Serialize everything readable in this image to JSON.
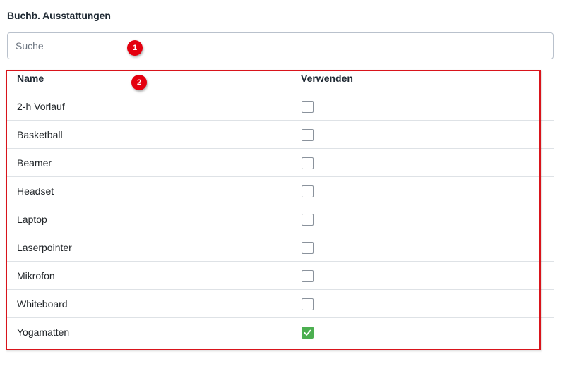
{
  "section": {
    "title": "Buchb. Ausstattungen"
  },
  "search": {
    "placeholder": "Suche",
    "value": ""
  },
  "annotations": {
    "badge_1": "1",
    "badge_2": "2",
    "highlight_color": "#d9141b",
    "badge_color": "#e4000f"
  },
  "table": {
    "headers": {
      "name": "Name",
      "use": "Verwenden"
    },
    "rows": [
      {
        "name": "2-h Vorlauf",
        "checked": false
      },
      {
        "name": "Basketball",
        "checked": false
      },
      {
        "name": "Beamer",
        "checked": false
      },
      {
        "name": "Headset",
        "checked": false
      },
      {
        "name": "Laptop",
        "checked": false
      },
      {
        "name": "Laserpointer",
        "checked": false
      },
      {
        "name": "Mikrofon",
        "checked": false
      },
      {
        "name": "Whiteboard",
        "checked": false
      },
      {
        "name": "Yogamatten",
        "checked": true
      }
    ]
  },
  "colors": {
    "checked": "#4caf50",
    "border": "#b9c1cc"
  }
}
